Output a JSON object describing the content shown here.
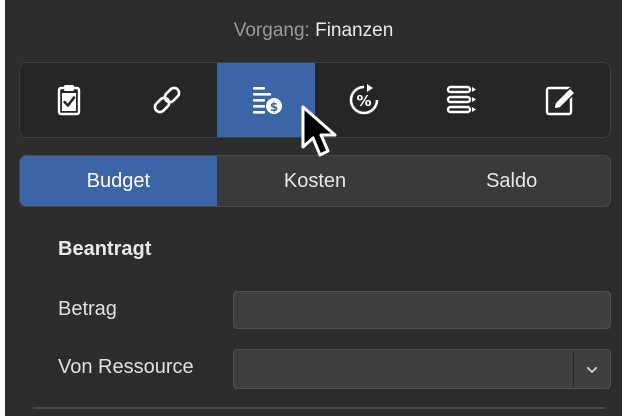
{
  "header": {
    "prefix": "Vorgang:",
    "value": "Finanzen"
  },
  "toolbar": {
    "buttons": [
      {
        "icon": "clipboard-check-icon",
        "active": false
      },
      {
        "icon": "link-icon",
        "active": false
      },
      {
        "icon": "finance-list-icon",
        "active": true
      },
      {
        "icon": "percent-cycle-icon",
        "active": false
      },
      {
        "icon": "list-icon",
        "active": false
      },
      {
        "icon": "edit-pencil-icon",
        "active": false
      }
    ]
  },
  "tabs": [
    {
      "label": "Budget",
      "active": true
    },
    {
      "label": "Kosten",
      "active": false
    },
    {
      "label": "Saldo",
      "active": false
    }
  ],
  "form": {
    "section_title": "Beantragt",
    "amount_label": "Betrag",
    "amount_value": "",
    "resource_label": "Von Ressource",
    "resource_value": ""
  },
  "colors": {
    "panel_bg": "#2d2d2d",
    "accent": "#3b65a7"
  }
}
